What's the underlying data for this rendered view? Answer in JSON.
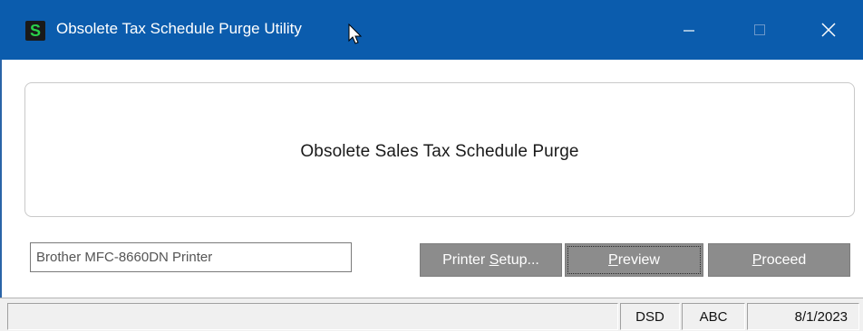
{
  "window": {
    "title": "Obsolete Tax Schedule Purge Utility",
    "app_icon_letter": "S",
    "title_bar_color": "#0b5cad"
  },
  "panel": {
    "heading": "Obsolete Sales Tax Schedule Purge"
  },
  "printer": {
    "value": "Brother MFC-8660DN Printer"
  },
  "buttons": {
    "setup_prefix": "Printer ",
    "setup_accel": "S",
    "setup_suffix": "etup...",
    "preview_accel": "P",
    "preview_rest": "review",
    "proceed_accel": "P",
    "proceed_rest": "roceed"
  },
  "statusbar": {
    "message": "",
    "company": "DSD",
    "user": "ABC",
    "date": "8/1/2023"
  }
}
